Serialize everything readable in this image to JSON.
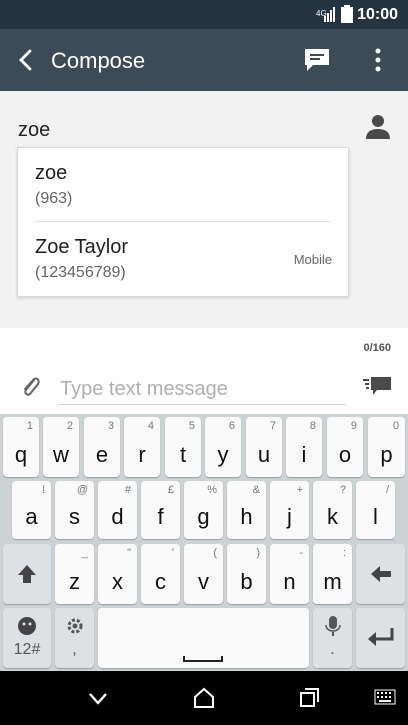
{
  "status_bar": {
    "time": "10:00",
    "icons": [
      "signal-icon",
      "battery-icon"
    ]
  },
  "app_bar": {
    "back_icon": "back-arrow-icon",
    "title": "Compose",
    "actions": [
      "message-icon",
      "more-vert-icon"
    ]
  },
  "recipient": {
    "value": "zoe",
    "icon": "person-icon"
  },
  "suggestions": [
    {
      "name": "zoe",
      "number": "(963)",
      "type": ""
    },
    {
      "name": "Zoe Taylor",
      "number": "(123456789)",
      "type": "Mobile"
    }
  ],
  "compose": {
    "counter": "0/160",
    "placeholder": "Type text message",
    "attach_icon": "paperclip-icon",
    "send_icon": "send-message-icon"
  },
  "keyboard": {
    "row1": [
      {
        "main": "q",
        "sub": "1"
      },
      {
        "main": "w",
        "sub": "2"
      },
      {
        "main": "e",
        "sub": "3"
      },
      {
        "main": "r",
        "sub": "4"
      },
      {
        "main": "t",
        "sub": "5"
      },
      {
        "main": "y",
        "sub": "6"
      },
      {
        "main": "u",
        "sub": "7"
      },
      {
        "main": "i",
        "sub": "8"
      },
      {
        "main": "o",
        "sub": "9"
      },
      {
        "main": "p",
        "sub": "0"
      }
    ],
    "row2": [
      {
        "main": "a",
        "sub": "!"
      },
      {
        "main": "s",
        "sub": "@"
      },
      {
        "main": "d",
        "sub": "#"
      },
      {
        "main": "f",
        "sub": "£"
      },
      {
        "main": "g",
        "sub": "%"
      },
      {
        "main": "h",
        "sub": "&"
      },
      {
        "main": "j",
        "sub": "+"
      },
      {
        "main": "k",
        "sub": "?"
      },
      {
        "main": "l",
        "sub": "/"
      }
    ],
    "row3": [
      {
        "main": "z",
        "sub": "_"
      },
      {
        "main": "x",
        "sub": "\""
      },
      {
        "main": "c",
        "sub": "'"
      },
      {
        "main": "v",
        "sub": "("
      },
      {
        "main": "b",
        "sub": ")"
      },
      {
        "main": "n",
        "sub": "-"
      },
      {
        "main": "m",
        "sub": ":"
      }
    ],
    "symbols_label": "12#",
    "settings_sub": ",",
    "mic_sub": "."
  },
  "nav_bar": {
    "icons": [
      "back-chevron-icon",
      "home-icon",
      "recents-icon",
      "keyboard-icon"
    ]
  }
}
